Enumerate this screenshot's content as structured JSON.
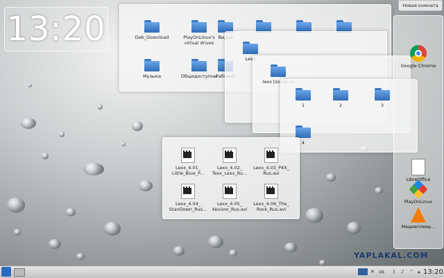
{
  "clock": {
    "time": "13:20"
  },
  "top_button": {
    "label": "Новая комната"
  },
  "folderview1": {
    "items": [
      "Deb_Download",
      "PlayOnLinux's virtual drives",
      "Видео",
      "Музыка",
      "Общедоступны",
      "Рабочий"
    ]
  },
  "folderview2": {
    "items": [
      "Lexx"
    ]
  },
  "folderview3": {
    "items": [
      "lexx [zona] ru"
    ]
  },
  "folderview4": {
    "items": [
      "1",
      "2",
      "3",
      "4"
    ]
  },
  "videoview": {
    "items": [
      "Lexx_4.01_ Little_Blue_P...",
      "Lexx_4.02_ Texx_Lexx_Ru...",
      "Lexx_4.03_P4X_ Rus.avi",
      "Lexx_4.04_ StanDown_Rus...",
      "Lexx_4.05_ Xevivor_Rus.avi",
      "Lexx_4.06_The_ Rock_Rus.avi"
    ]
  },
  "dock": {
    "items": [
      {
        "label": "Google Chrome",
        "icon": "chrome-icon"
      },
      {
        "label": "LibreOffice",
        "icon": "libreoffice-icon"
      },
      {
        "label": "PlayOnLinux",
        "icon": "playonlinux-icon"
      },
      {
        "label": "Медиаплеер...",
        "icon": "vlc-icon"
      }
    ]
  },
  "taskbar": {
    "keyboard_layout": "us",
    "time": "13:20"
  },
  "watermark": {
    "text": "YAPLAKAL.COM"
  }
}
